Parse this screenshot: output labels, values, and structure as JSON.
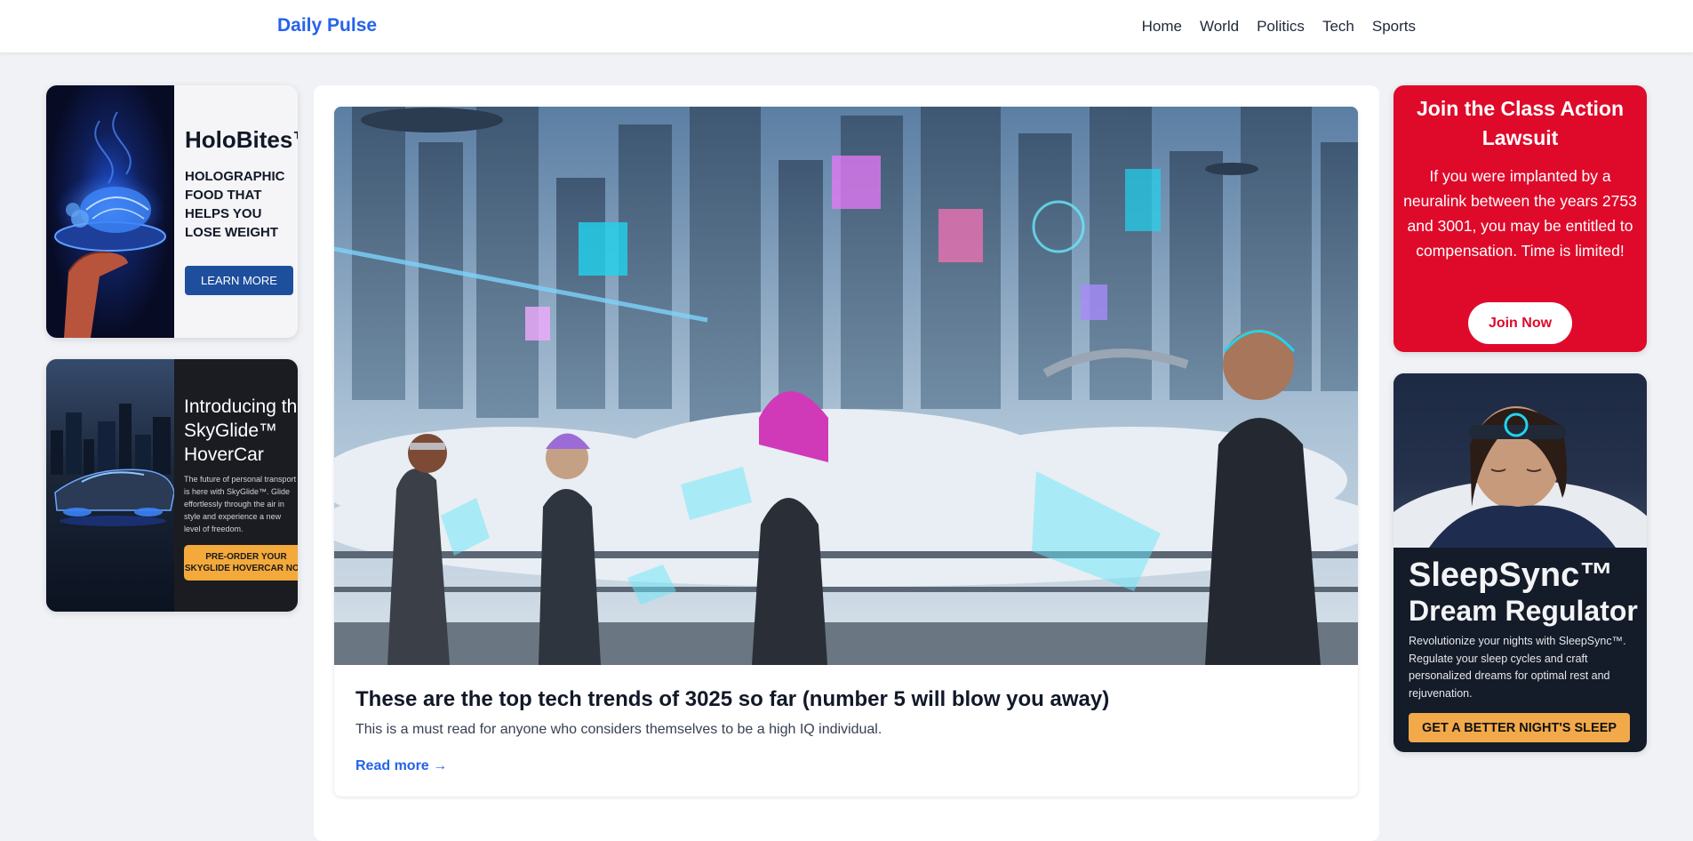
{
  "header": {
    "logo": "Daily Pulse",
    "nav": [
      "Home",
      "World",
      "Politics",
      "Tech",
      "Sports"
    ]
  },
  "left_ads": {
    "holobites": {
      "title": "HoloBites™",
      "description": "HOLOGRAPHIC FOOD THAT HELPS YOU LOSE WEIGHT",
      "button": "LEARN MORE"
    },
    "skyglide": {
      "title_line1": "Introducing the",
      "title_line2": "SkyGlide™",
      "title_line3": "HoverCar",
      "description": "The future of personal transport is here with SkyGlide™. Glide effortlessly through the air in style and experience a new level of freedom.",
      "button_line1": "PRE-ORDER YOUR",
      "button_line2": "SKYGLIDE HOVERCAR NOW"
    }
  },
  "article": {
    "title": "These are the top tech trends of 3025 so far (number 5 will blow you away)",
    "summary": "This is a must read for anyone who considers themselves to be a high IQ individual.",
    "read_more": "Read more →"
  },
  "right_ads": {
    "lawsuit": {
      "title": "Join the Class Action Lawsuit",
      "body": "If you were implanted by a neuralink between the years 2753 and 3001, you may be entitled to compensation. Time is limited!",
      "button": "Join Now"
    },
    "sleepsync": {
      "title_line1": "SleepSync™",
      "title_line2": "Dream Regulator",
      "description": "Revolutionize your nights with SleepSync™. Regulate your sleep cycles and craft personalized dreams for optimal rest and rejuvenation.",
      "button": "GET A BETTER NIGHT'S SLEEP"
    }
  }
}
